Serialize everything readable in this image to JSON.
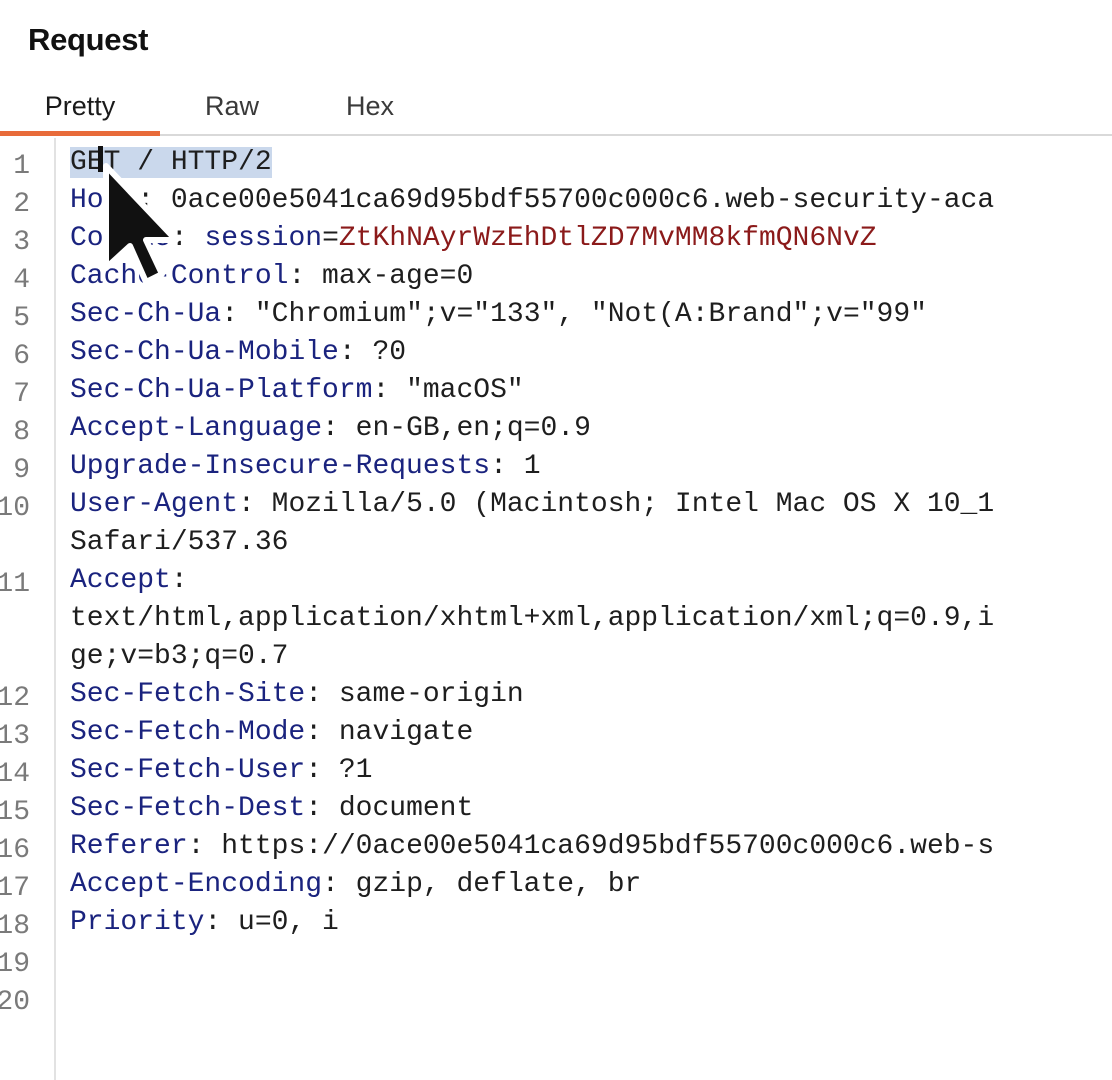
{
  "panel": {
    "title": "Request"
  },
  "tabs": [
    {
      "label": "Pretty",
      "active": true
    },
    {
      "label": "Raw",
      "active": false
    },
    {
      "label": "Hex",
      "active": false
    }
  ],
  "editor": {
    "line_numbers": [
      "1",
      "2",
      "3",
      "4",
      "5",
      "6",
      "7",
      "8",
      "9",
      "10",
      "11",
      "12",
      "13",
      "14",
      "15",
      "16",
      "17",
      "18",
      "19",
      "20"
    ],
    "lines": {
      "l1": "GET / HTTP/2",
      "l2": {
        "key": "Host",
        "sep": ": ",
        "value": "0ace00e5041ca69d95bdf55700c000c6.web-security-aca"
      },
      "l3": {
        "key": "Cookie",
        "sep": ": ",
        "cookie_name": "session",
        "eq": "=",
        "cookie_value": "ZtKhNAyrWzEhDtlZD7MvMM8kfmQN6NvZ"
      },
      "l4": {
        "key": "Cache-Control",
        "sep": ": ",
        "value": "max-age=0"
      },
      "l5": {
        "key": "Sec-Ch-Ua",
        "sep": ": ",
        "value": "\"Chromium\";v=\"133\", \"Not(A:Brand\";v=\"99\""
      },
      "l6": {
        "key": "Sec-Ch-Ua-Mobile",
        "sep": ": ",
        "value": "?0"
      },
      "l7": {
        "key": "Sec-Ch-Ua-Platform",
        "sep": ": ",
        "value": "\"macOS\""
      },
      "l8": {
        "key": "Accept-Language",
        "sep": ": ",
        "value": "en-GB,en;q=0.9"
      },
      "l9": {
        "key": "Upgrade-Insecure-Requests",
        "sep": ": ",
        "value": "1"
      },
      "l10": {
        "key": "User-Agent",
        "sep": ": ",
        "value": "Mozilla/5.0 (Macintosh; Intel Mac OS X 10_1",
        "wrap": "Safari/537.36"
      },
      "l11": {
        "key": "Accept",
        "sep": ":",
        "wrap1": "text/html,application/xhtml+xml,application/xml;q=0.9,i",
        "wrap2": "ge;v=b3;q=0.7"
      },
      "l12": {
        "key": "Sec-Fetch-Site",
        "sep": ": ",
        "value": "same-origin"
      },
      "l13": {
        "key": "Sec-Fetch-Mode",
        "sep": ": ",
        "value": "navigate"
      },
      "l14": {
        "key": "Sec-Fetch-User",
        "sep": ": ",
        "value": "?1"
      },
      "l15": {
        "key": "Sec-Fetch-Dest",
        "sep": ": ",
        "value": "document"
      },
      "l16": {
        "key": "Referer",
        "sep": ": ",
        "value": "https://0ace00e5041ca69d95bdf55700c000c6.web-s"
      },
      "l17": {
        "key": "Accept-Encoding",
        "sep": ": ",
        "value": "gzip, deflate, br"
      },
      "l18": {
        "key": "Priority",
        "sep": ": ",
        "value": "u=0, i"
      }
    }
  },
  "icons": {
    "cursor": "mouse-pointer-icon"
  },
  "colors": {
    "accent": "#e86b3a",
    "header_key": "#1a237e",
    "cookie_value": "#8b1a1a",
    "selection": "#cad8ec"
  }
}
